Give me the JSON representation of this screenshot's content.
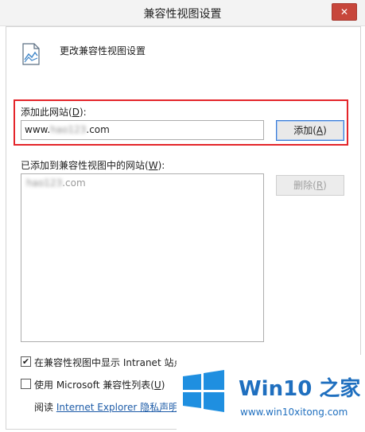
{
  "window": {
    "title": "兼容性视图设置",
    "close_glyph": "✕"
  },
  "header": {
    "icon": "page-compat-icon",
    "text": "更改兼容性视图设置"
  },
  "add_site": {
    "label_prefix": "添加此网站(",
    "label_key": "D",
    "label_suffix": "):",
    "input_prefix": "www.",
    "input_blurred": "hao123",
    "input_suffix": ".com",
    "add_button_prefix": "添加(",
    "add_button_key": "A",
    "add_button_suffix": ")"
  },
  "added_sites": {
    "label_prefix": "已添加到兼容性视图中的网站(",
    "label_key": "W",
    "label_suffix": "):",
    "items": [
      {
        "blurred": "hao123",
        "suffix": ".com"
      }
    ],
    "remove_button_prefix": "删除(",
    "remove_button_key": "R",
    "remove_button_suffix": ")"
  },
  "options": {
    "intranet": {
      "checked": true,
      "check_glyph": "✔",
      "label": "在兼容性视图中显示 Intranet 站点(I)"
    },
    "mslist": {
      "checked": false,
      "label_prefix": "使用 Microsoft 兼容性列表(",
      "label_key": "U",
      "label_suffix": ")"
    }
  },
  "footer": {
    "read_label": "阅读",
    "link_text": "Internet Explorer 隐私声明"
  },
  "watermark": {
    "title": "Win10 之家",
    "url": "www.win10xitong.com",
    "logo_color": "#1f8fe0"
  }
}
